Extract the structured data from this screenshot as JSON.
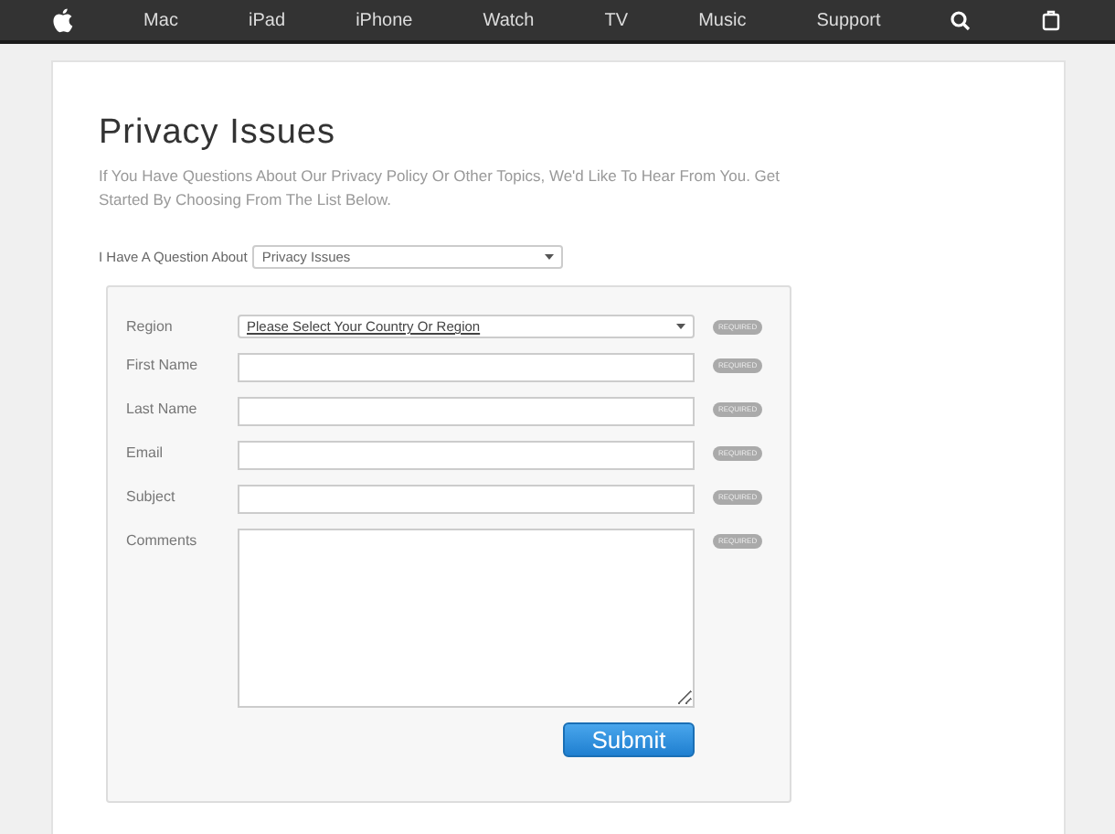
{
  "nav": {
    "items": [
      {
        "kind": "logo"
      },
      {
        "kind": "text",
        "label": "Mac"
      },
      {
        "kind": "text",
        "label": "iPad"
      },
      {
        "kind": "text",
        "label": "iPhone"
      },
      {
        "kind": "text",
        "label": "Watch"
      },
      {
        "kind": "text",
        "label": "TV"
      },
      {
        "kind": "text",
        "label": "Music"
      },
      {
        "kind": "text",
        "label": "Support"
      },
      {
        "kind": "search"
      },
      {
        "kind": "bag"
      }
    ]
  },
  "title": "Privacy Issues",
  "intro": "If You Have Questions About Our Privacy Policy Or Other Topics, We'd Like To Hear From You. Get Started By Choosing From The List Below.",
  "topic": {
    "label": "I Have A Question About",
    "value": "Privacy Issues"
  },
  "form": {
    "fields": [
      {
        "kind": "select",
        "label": "Region",
        "value": "Please Select Your Country Or Region",
        "badge": "REQUIRED"
      },
      {
        "kind": "text",
        "label": "First Name",
        "badge": "REQUIRED"
      },
      {
        "kind": "text",
        "label": "Last Name",
        "badge": "REQUIRED"
      },
      {
        "kind": "text",
        "label": "Email",
        "badge": "REQUIRED"
      },
      {
        "kind": "text",
        "label": "Subject",
        "badge": "REQUIRED"
      },
      {
        "kind": "textarea",
        "label": "Comments",
        "badge": "REQUIRED"
      }
    ],
    "submit": "Submit"
  }
}
